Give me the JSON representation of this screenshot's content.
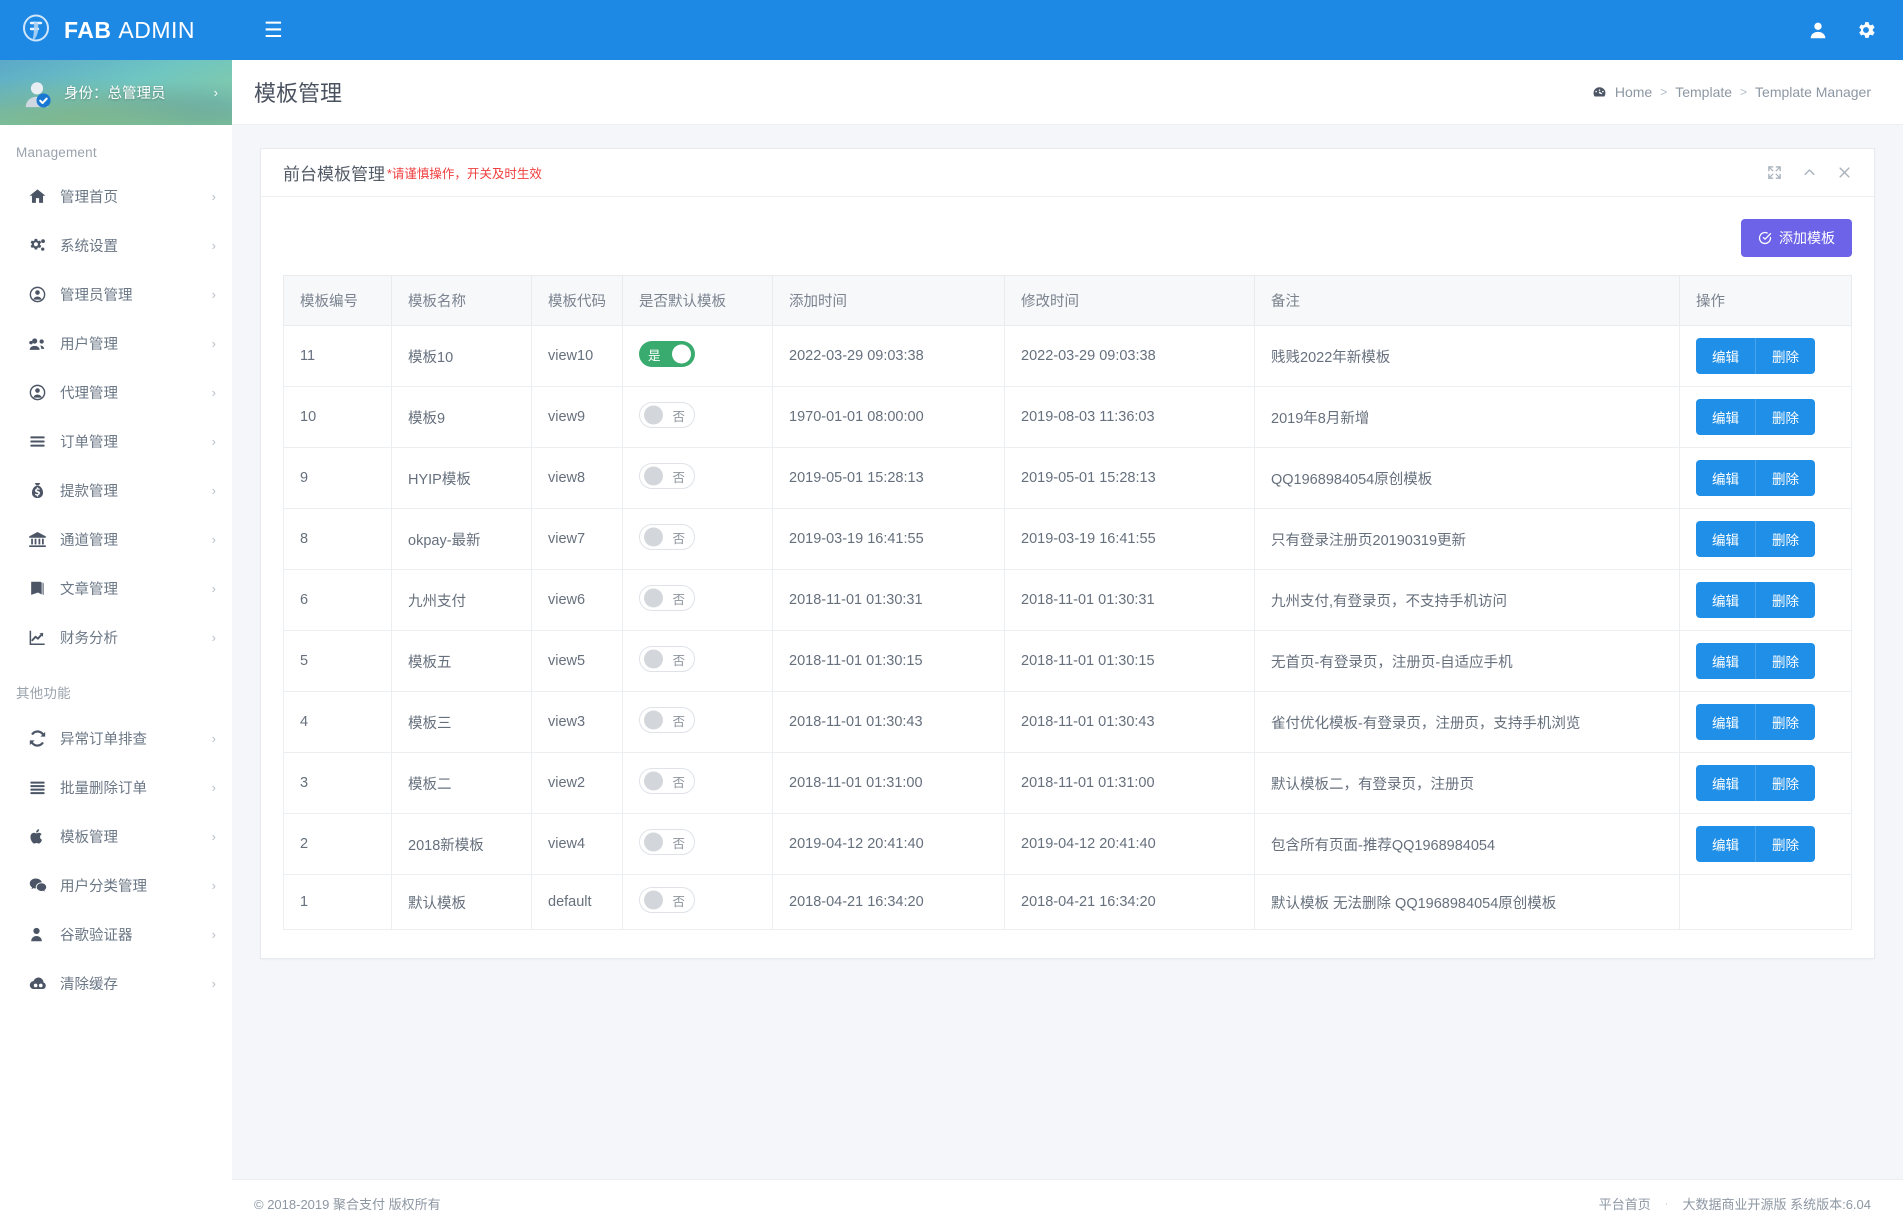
{
  "brand": {
    "bold": "FAB",
    "light": "ADMIN"
  },
  "topbar": {
    "menu_toggle_icon": "hamburger-icon",
    "user_icon": "user-icon",
    "settings_icon": "gear-icon"
  },
  "sidebar": {
    "user": {
      "name": "身份：总管理员",
      "chevron": "›"
    },
    "sections": [
      {
        "header": "Management",
        "items": [
          {
            "label": "管理首页",
            "icon": "home-icon",
            "chevron": "›"
          },
          {
            "label": "系统设置",
            "icon": "gears-icon",
            "chevron": "›"
          },
          {
            "label": "管理员管理",
            "icon": "user-circle-icon",
            "chevron": "›"
          },
          {
            "label": "用户管理",
            "icon": "users-icon",
            "chevron": "›"
          },
          {
            "label": "代理管理",
            "icon": "user-circle-icon",
            "chevron": "›"
          },
          {
            "label": "订单管理",
            "icon": "list-icon",
            "chevron": "›"
          },
          {
            "label": "提款管理",
            "icon": "money-bag-icon",
            "chevron": "›"
          },
          {
            "label": "通道管理",
            "icon": "bank-icon",
            "chevron": "›"
          },
          {
            "label": "文章管理",
            "icon": "book-icon",
            "chevron": "›"
          },
          {
            "label": "财务分析",
            "icon": "chart-line-icon",
            "chevron": "›"
          }
        ]
      },
      {
        "header": "其他功能",
        "items": [
          {
            "label": "异常订单排查",
            "icon": "refresh-icon",
            "chevron": "›"
          },
          {
            "label": "批量删除订单",
            "icon": "list-icon",
            "chevron": "›"
          },
          {
            "label": "模板管理",
            "icon": "apple-icon",
            "chevron": "›"
          },
          {
            "label": "用户分类管理",
            "icon": "wechat-icon",
            "chevron": "›"
          },
          {
            "label": "谷歌验证器",
            "icon": "person-icon",
            "chevron": "›"
          },
          {
            "label": "清除缓存",
            "icon": "cloud-icon",
            "chevron": "›"
          }
        ]
      }
    ]
  },
  "page": {
    "title": "模板管理",
    "breadcrumb": {
      "home_icon": "dashboard-icon",
      "items": [
        "Home",
        "Template",
        "Template Manager"
      ],
      "separator": ">"
    }
  },
  "panel": {
    "title": "前台模板管理",
    "warning": "*请谨慎操作，开关及时生效",
    "tools": [
      {
        "icon": "expand-icon"
      },
      {
        "icon": "chevron-up-icon"
      },
      {
        "icon": "close-icon"
      }
    ],
    "add_button": {
      "label": "添加模板",
      "icon": "check-circle-icon",
      "color": "#6c63e8"
    }
  },
  "table": {
    "headers": [
      "模板编号",
      "模板名称",
      "模板代码",
      "是否默认模板",
      "添加时间",
      "修改时间",
      "备注",
      "操作"
    ],
    "toggle_on_label": "是",
    "toggle_off_label": "否",
    "action_labels": {
      "edit": "编辑",
      "delete": "删除"
    },
    "rows": [
      {
        "id": "11",
        "name": "模板10",
        "code": "view10",
        "is_default": true,
        "added": "2022-03-29 09:03:38",
        "modified": "2022-03-29 09:03:38",
        "remark": "贱贱2022年新模板",
        "has_actions": true
      },
      {
        "id": "10",
        "name": "模板9",
        "code": "view9",
        "is_default": false,
        "added": "1970-01-01 08:00:00",
        "modified": "2019-08-03 11:36:03",
        "remark": "2019年8月新增",
        "has_actions": true
      },
      {
        "id": "9",
        "name": "HYIP模板",
        "code": "view8",
        "is_default": false,
        "added": "2019-05-01 15:28:13",
        "modified": "2019-05-01 15:28:13",
        "remark": "QQ1968984054原创模板",
        "has_actions": true
      },
      {
        "id": "8",
        "name": "okpay-最新",
        "code": "view7",
        "is_default": false,
        "added": "2019-03-19 16:41:55",
        "modified": "2019-03-19 16:41:55",
        "remark": "只有登录注册页20190319更新",
        "has_actions": true
      },
      {
        "id": "6",
        "name": "九州支付",
        "code": "view6",
        "is_default": false,
        "added": "2018-11-01 01:30:31",
        "modified": "2018-11-01 01:30:31",
        "remark": "九州支付,有登录页，不支持手机访问",
        "has_actions": true
      },
      {
        "id": "5",
        "name": "模板五",
        "code": "view5",
        "is_default": false,
        "added": "2018-11-01 01:30:15",
        "modified": "2018-11-01 01:30:15",
        "remark": "无首页-有登录页，注册页-自适应手机",
        "has_actions": true
      },
      {
        "id": "4",
        "name": "模板三",
        "code": "view3",
        "is_default": false,
        "added": "2018-11-01 01:30:43",
        "modified": "2018-11-01 01:30:43",
        "remark": "雀付优化模板-有登录页，注册页，支持手机浏览",
        "has_actions": true
      },
      {
        "id": "3",
        "name": "模板二",
        "code": "view2",
        "is_default": false,
        "added": "2018-11-01 01:31:00",
        "modified": "2018-11-01 01:31:00",
        "remark": "默认模板二，有登录页，注册页",
        "has_actions": true
      },
      {
        "id": "2",
        "name": "2018新模板",
        "code": "view4",
        "is_default": false,
        "added": "2019-04-12 20:41:40",
        "modified": "2019-04-12 20:41:40",
        "remark": "包含所有页面-推荐QQ1968984054",
        "has_actions": true
      },
      {
        "id": "1",
        "name": "默认模板",
        "code": "default",
        "is_default": false,
        "added": "2018-04-21 16:34:20",
        "modified": "2018-04-21 16:34:20",
        "remark": "默认模板 无法删除 QQ1968984054原创模板",
        "has_actions": false
      }
    ]
  },
  "footer": {
    "copyright": "© 2018-2019 聚合支付 版权所有",
    "home_link": "平台首页",
    "separator": "·",
    "version": "大数据商业开源版 系统版本:6.04"
  }
}
